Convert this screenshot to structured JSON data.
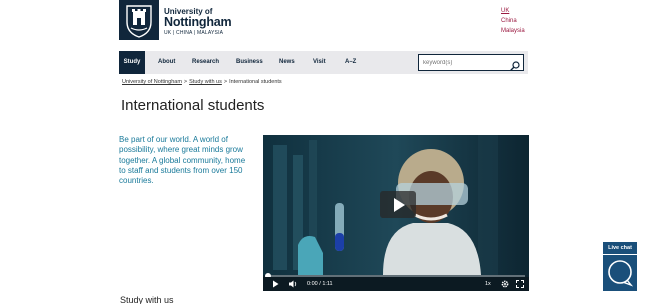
{
  "logo": {
    "university_of": "University of",
    "name": "Nottingham",
    "campuses": "UK | CHINA | MALAYSIA"
  },
  "campus_links": [
    {
      "label": "UK",
      "active": true
    },
    {
      "label": "China",
      "active": false
    },
    {
      "label": "Malaysia",
      "active": false
    }
  ],
  "nav": {
    "items": [
      {
        "label": "Study",
        "active": true
      },
      {
        "label": "About",
        "active": false
      },
      {
        "label": "Research",
        "active": false
      },
      {
        "label": "Business",
        "active": false
      },
      {
        "label": "News",
        "active": false
      },
      {
        "label": "Visit",
        "active": false
      },
      {
        "label": "A–Z",
        "active": false
      }
    ],
    "search_placeholder": "keyword(s)"
  },
  "breadcrumb": {
    "items": [
      "University of Nottingham",
      "Study with us",
      "International students"
    ],
    "separator": ">"
  },
  "page_title": "International students",
  "intro": "Be part of our world. A world of possibility, where great minds grow together. A global community, home to staff and students from over 150 countries.",
  "video": {
    "time_current": "0:00",
    "time_separator": "/",
    "time_total": "1:11",
    "speed": "1x",
    "progress_fraction": 0.0
  },
  "live_chat": {
    "label": "Live chat"
  },
  "section_heading": "Study with us",
  "colors": {
    "brand_navy": "#10263b",
    "campus_link": "#9b1a41",
    "intro_teal": "#1a7a9a",
    "chat_blue": "#1a4f7a"
  }
}
